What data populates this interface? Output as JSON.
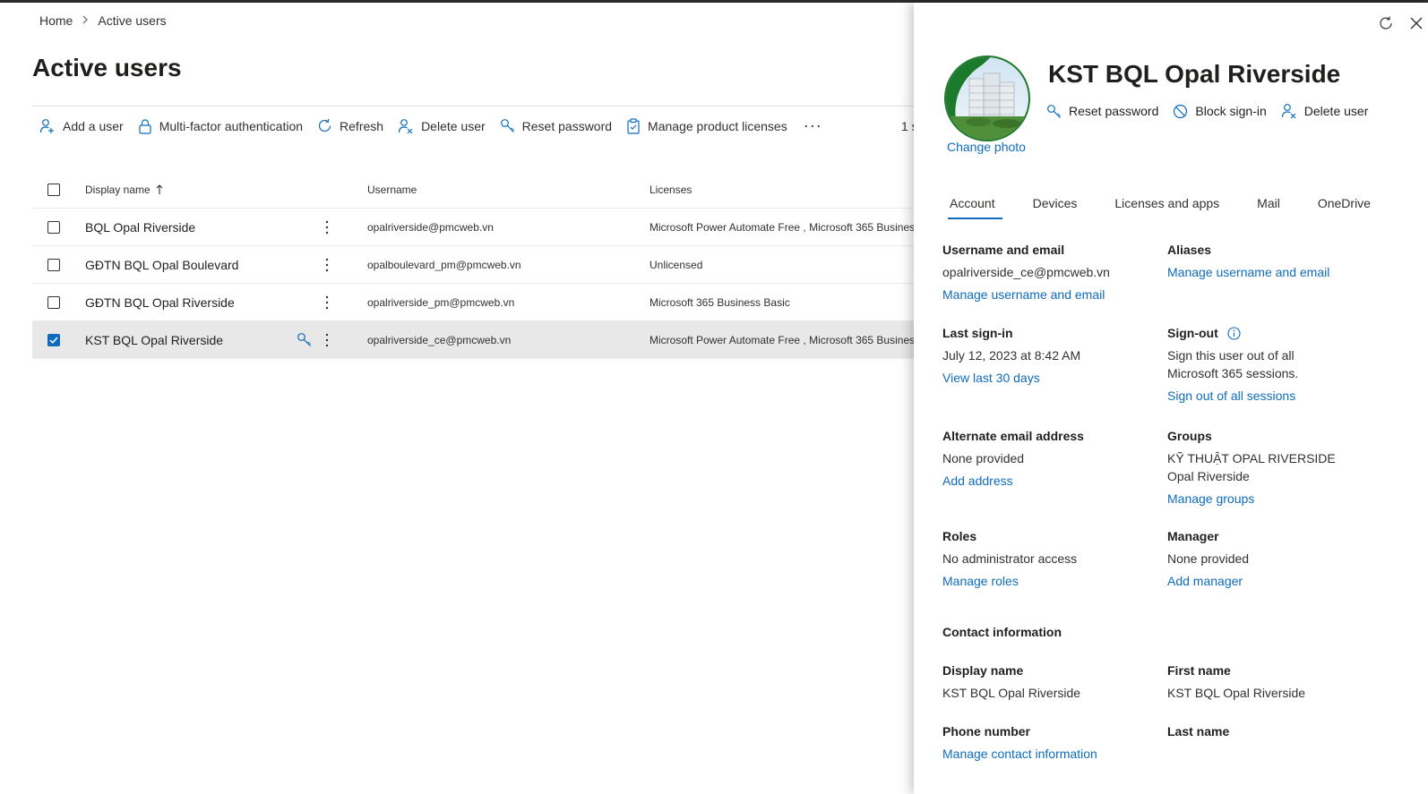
{
  "breadcrumb": {
    "home": "Home",
    "current": "Active users"
  },
  "page": {
    "title": "Active users",
    "selected_count": "1 s"
  },
  "toolbar": {
    "add_user": "Add a user",
    "mfa": "Multi-factor authentication",
    "refresh": "Refresh",
    "delete_user": "Delete user",
    "reset_password": "Reset password",
    "manage_licenses": "Manage product licenses",
    "more": "···"
  },
  "grid": {
    "headers": {
      "display_name": "Display name",
      "username": "Username",
      "licenses": "Licenses"
    },
    "rows": [
      {
        "name": "BQL Opal Riverside",
        "username": "opalriverside@pmcweb.vn",
        "licenses": "Microsoft Power Automate Free , Microsoft 365 Business",
        "checked": false
      },
      {
        "name": "GĐTN BQL Opal Boulevard",
        "username": "opalboulevard_pm@pmcweb.vn",
        "licenses": "Unlicensed",
        "checked": false
      },
      {
        "name": "GĐTN BQL Opal Riverside",
        "username": "opalriverside_pm@pmcweb.vn",
        "licenses": "Microsoft 365 Business Basic",
        "checked": false
      },
      {
        "name": "KST BQL Opal Riverside",
        "username": "opalriverside_ce@pmcweb.vn",
        "licenses": "Microsoft Power Automate Free , Microsoft 365 Business",
        "checked": true
      }
    ]
  },
  "panel": {
    "user_name": "KST BQL Opal Riverside",
    "change_photo": "Change photo",
    "actions": {
      "reset_password": "Reset password",
      "block_signin": "Block sign-in",
      "delete_user": "Delete user"
    },
    "tabs": [
      "Account",
      "Devices",
      "Licenses and apps",
      "Mail",
      "OneDrive"
    ],
    "account": {
      "username_label": "Username and email",
      "username_value": "opalriverside_ce@pmcweb.vn",
      "username_link": "Manage username and email",
      "aliases_label": "Aliases",
      "aliases_link": "Manage username and email",
      "last_signin_label": "Last sign-in",
      "last_signin_value": "July 12, 2023 at 8:42 AM",
      "last_signin_link": "View last 30 days",
      "signout_label": "Sign-out",
      "signout_text": "Sign this user out of all Microsoft 365 sessions.",
      "signout_link": "Sign out of all sessions",
      "alt_email_label": "Alternate email address",
      "alt_email_value": "None provided",
      "alt_email_link": "Add address",
      "groups_label": "Groups",
      "groups_value_1": "KỸ THUẬT OPAL RIVERSIDE",
      "groups_value_2": "Opal Riverside",
      "groups_link": "Manage groups",
      "roles_label": "Roles",
      "roles_value": "No administrator access",
      "roles_link": "Manage roles",
      "manager_label": "Manager",
      "manager_value": "None provided",
      "manager_link": "Add manager",
      "contact_header": "Contact information",
      "display_name_label": "Display name",
      "display_name_value": "KST BQL Opal Riverside",
      "first_name_label": "First name",
      "first_name_value": "KST BQL Opal Riverside",
      "phone_label": "Phone number",
      "phone_link": "Manage contact information",
      "last_name_label": "Last name"
    }
  },
  "colors": {
    "accent": "#0f6cbd",
    "selected_row": "#e8e8e8",
    "text": "#242424"
  },
  "icons": [
    "chevron-right-icon",
    "add-person-icon",
    "lock-icon",
    "refresh-icon",
    "remove-person-icon",
    "key-icon",
    "clipboard-icon",
    "more-icon",
    "sort-up-icon",
    "more-vertical-icon",
    "refresh-icon",
    "close-icon",
    "block-icon",
    "info-icon"
  ]
}
